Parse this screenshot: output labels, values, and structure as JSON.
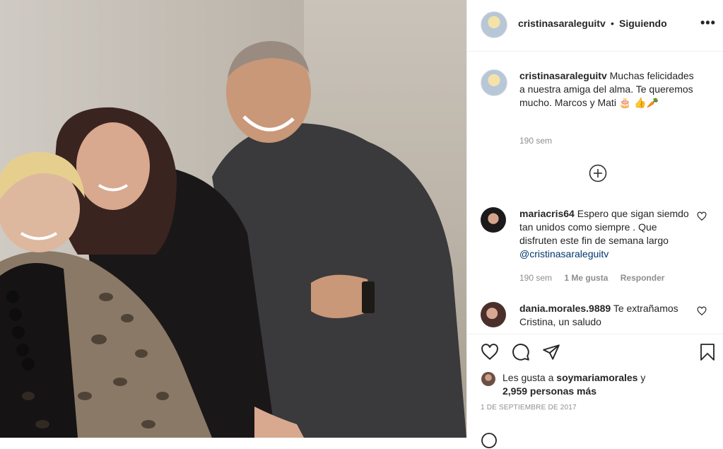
{
  "post": {
    "username": "cristinasaraleguitv",
    "separator": "•",
    "follow_state": "Siguiendo",
    "more_icon": "more-options-icon"
  },
  "caption": {
    "username": "cristinasaraleguitv",
    "text": "Muchas felicidades a nuestra amiga del alma. Te queremos mucho. Marcos y Mati 🎂 👍🥕",
    "time": "190 sem"
  },
  "load_more_icon": "plus-circle-icon",
  "comments": [
    {
      "username": "mariacris64",
      "text": "Espero que sigan siemdo tan unidos como siempre . Que disfruten este fin de semana largo",
      "mention": "@cristinasaraleguitv",
      "time": "190 sem",
      "likes": "1 Me gusta",
      "reply": "Responder"
    },
    {
      "username": "dania.morales.9889",
      "text": "Te extrañamos Cristina, un saludo"
    }
  ],
  "likes": {
    "prefix": "Les gusta a",
    "user": "soymariamorales",
    "connector": "y",
    "others": "2,959 personas más"
  },
  "date": "1 DE SEPTIEMBRE DE 2017",
  "colors": {
    "text": "#262626",
    "muted": "#8e8e8e",
    "mention": "#00376b",
    "border": "#efefef"
  }
}
